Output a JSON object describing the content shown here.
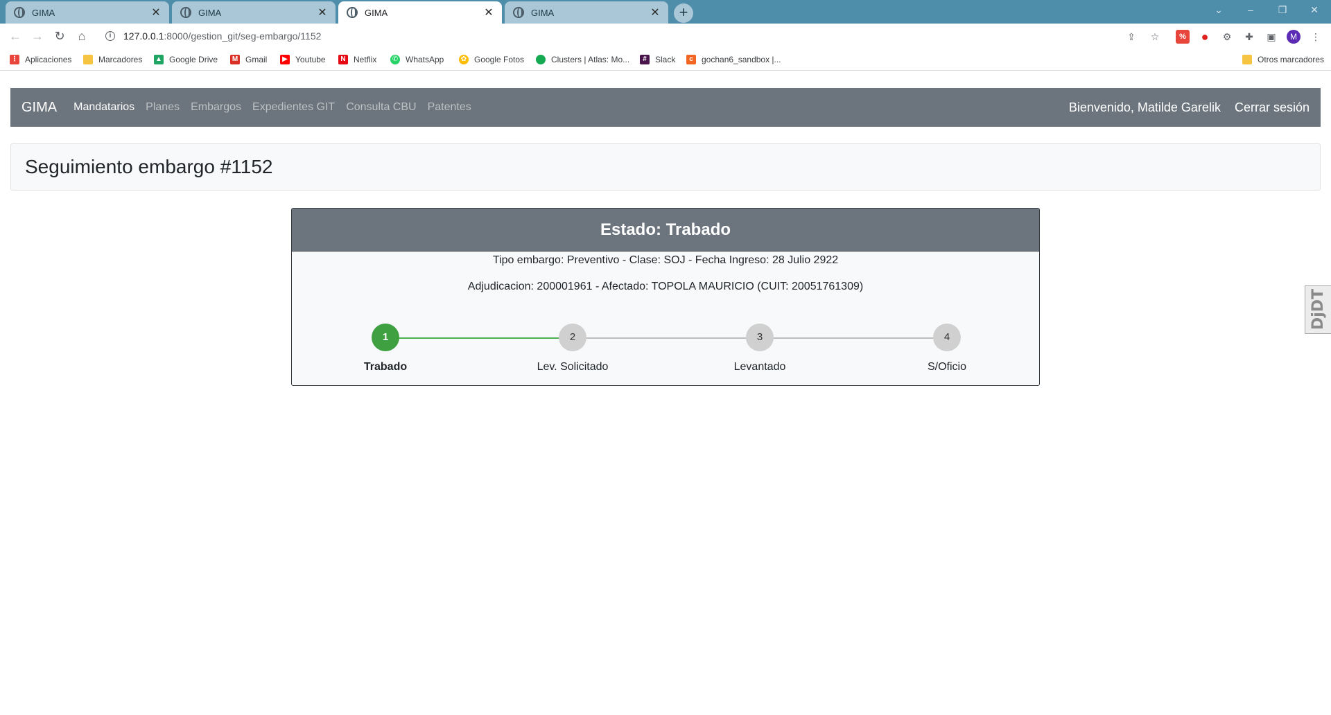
{
  "browser": {
    "tabs": [
      {
        "title": "GIMA",
        "active": false
      },
      {
        "title": "GIMA",
        "active": false
      },
      {
        "title": "GIMA",
        "active": true
      },
      {
        "title": "GIMA",
        "active": false
      }
    ],
    "url_host": "127.0.0.1",
    "url_path": ":8000/gestion_git/seg-embargo/1152",
    "bookmarks": [
      {
        "label": "Aplicaciones",
        "icon": "apps-grid-icon",
        "color": "#e8453c"
      },
      {
        "label": "Marcadores",
        "icon": "folder-icon",
        "color": "#f5c542"
      },
      {
        "label": "Google Drive",
        "icon": "google-drive-icon",
        "color": "#1fa463"
      },
      {
        "label": "Gmail",
        "icon": "gmail-icon",
        "color": "#d93025"
      },
      {
        "label": "Youtube",
        "icon": "youtube-icon",
        "color": "#ff0000"
      },
      {
        "label": "Netflix",
        "icon": "netflix-icon",
        "color": "#e50914"
      },
      {
        "label": "WhatsApp",
        "icon": "whatsapp-icon",
        "color": "#25d366"
      },
      {
        "label": "Google Fotos",
        "icon": "google-photos-icon",
        "color": "#fbbc04"
      },
      {
        "label": "Clusters | Atlas: Mo...",
        "icon": "mongodb-icon",
        "color": "#13aa52"
      },
      {
        "label": "Slack",
        "icon": "slack-icon",
        "color": "#4a154b"
      },
      {
        "label": "gochan6_sandbox |...",
        "icon": "cp-icon",
        "color": "#f26522"
      }
    ],
    "other_bookmarks": "Otros marcadores",
    "profile_initial": "M"
  },
  "navbar": {
    "brand": "GIMA",
    "links": [
      "Mandatarios",
      "Planes",
      "Embargos",
      "Expedientes GIT",
      "Consulta CBU",
      "Patentes"
    ],
    "active_index": 0,
    "welcome": "Bienvenido, Matilde Garelik",
    "logout": "Cerrar sesión"
  },
  "page": {
    "title": "Seguimiento embargo #1152"
  },
  "estado": {
    "heading": "Estado: Trabado",
    "line1": "Tipo embargo: Preventivo - Clase: SOJ - Fecha Ingreso: 28 Julio 2922",
    "line2": "Adjudicacion: 200001961 - Afectado: TOPOLA MAURICIO (CUIT: 20051761309)",
    "steps": [
      {
        "num": "1",
        "label": "Trabado",
        "done": true
      },
      {
        "num": "2",
        "label": "Lev. Solicitado",
        "done": false
      },
      {
        "num": "3",
        "label": "Levantado",
        "done": false
      },
      {
        "num": "4",
        "label": "S/Oficio",
        "done": false
      }
    ],
    "colors": {
      "done": "#3ea040",
      "pending": "#d0d0d0",
      "header": "#6c757d"
    }
  },
  "side_widget": {
    "label": "DjDT"
  }
}
